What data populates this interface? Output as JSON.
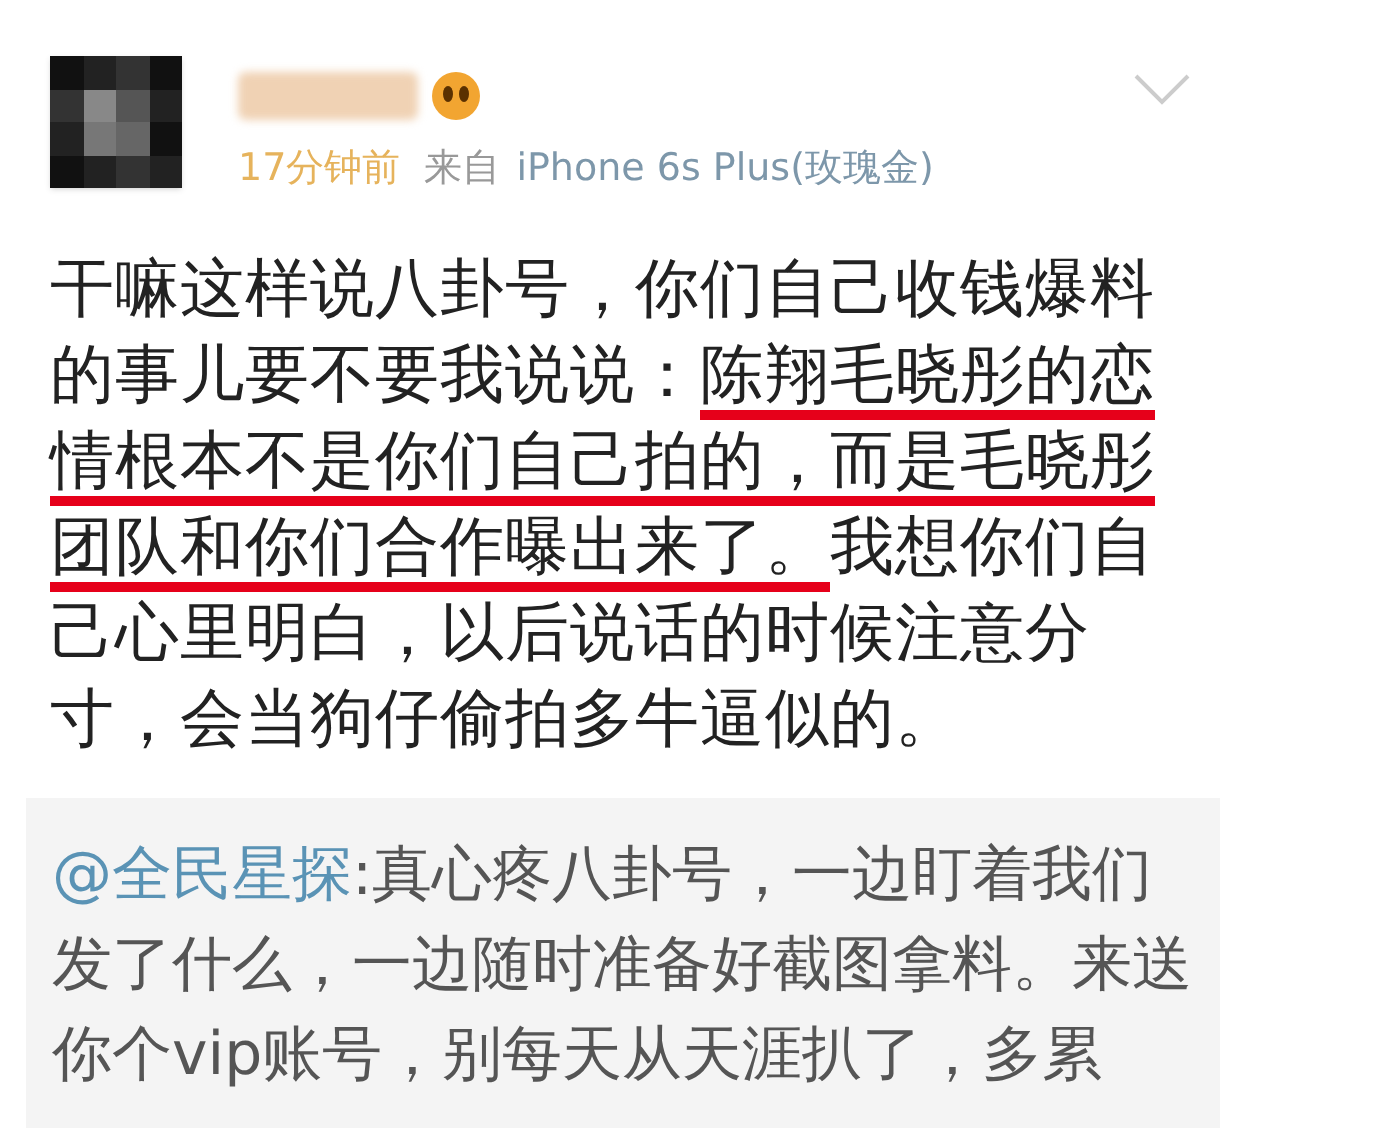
{
  "post": {
    "time": "17分钟前",
    "source_label": "来自",
    "source": "iPhone 6s Plus(玫瑰金)",
    "body": [
      {
        "text": "干嘛这样说八卦号，你们自己收钱爆料的事儿要不要我说说：",
        "marked": false
      },
      {
        "text": "陈翔毛晓彤的恋情根本不是你们自己拍的，而是毛晓彤团队和你们合作曝出来了。",
        "marked": true
      },
      {
        "text": "我想你们自己心里明白，以后说话的时候注意分寸，会当狗仔偷拍多牛逼似的。",
        "marked": false
      }
    ]
  },
  "repost": {
    "mention": "@全民星探",
    "text": ":真心疼八卦号，一边盯着我们发了什么，一边随时准备好截图拿料。来送你个vip账号，别每天从天涯扒了，多累"
  }
}
